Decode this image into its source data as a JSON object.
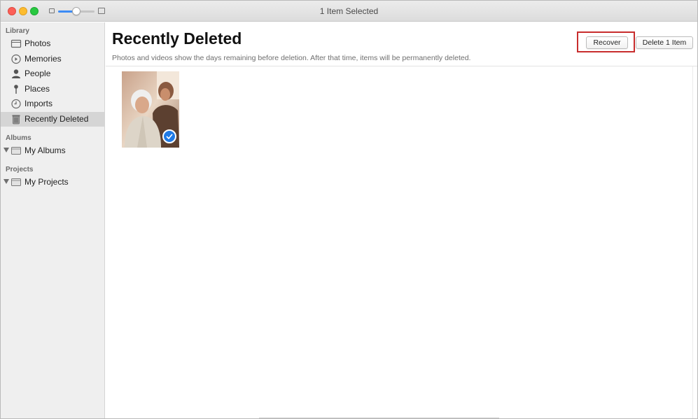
{
  "window": {
    "title": "1 Item Selected"
  },
  "toolbar": {
    "zoom_level": 0.5
  },
  "sidebar": {
    "sections": [
      {
        "title": "Library"
      },
      {
        "title": "Albums"
      },
      {
        "title": "Projects"
      }
    ],
    "library_items": [
      {
        "label": "Photos",
        "icon": "photos-icon"
      },
      {
        "label": "Memories",
        "icon": "memories-icon"
      },
      {
        "label": "People",
        "icon": "person-icon"
      },
      {
        "label": "Places",
        "icon": "pin-icon"
      },
      {
        "label": "Imports",
        "icon": "clock-icon"
      },
      {
        "label": "Recently Deleted",
        "icon": "trash-icon",
        "active": true
      }
    ],
    "albums_item": {
      "label": "My Albums",
      "icon": "album-folder-icon"
    },
    "projects_item": {
      "label": "My Projects",
      "icon": "project-folder-icon"
    }
  },
  "main": {
    "title": "Recently Deleted",
    "subtitle": "Photos and videos show the days remaining before deletion. After that time, items will be permanently deleted.",
    "recover_label": "Recover",
    "delete_label": "Delete 1 Item",
    "highlight_color": "#c82d2d"
  },
  "photo": {
    "selected": true,
    "badge_color": "#1f7ae6",
    "icon": "checkmark-icon"
  }
}
